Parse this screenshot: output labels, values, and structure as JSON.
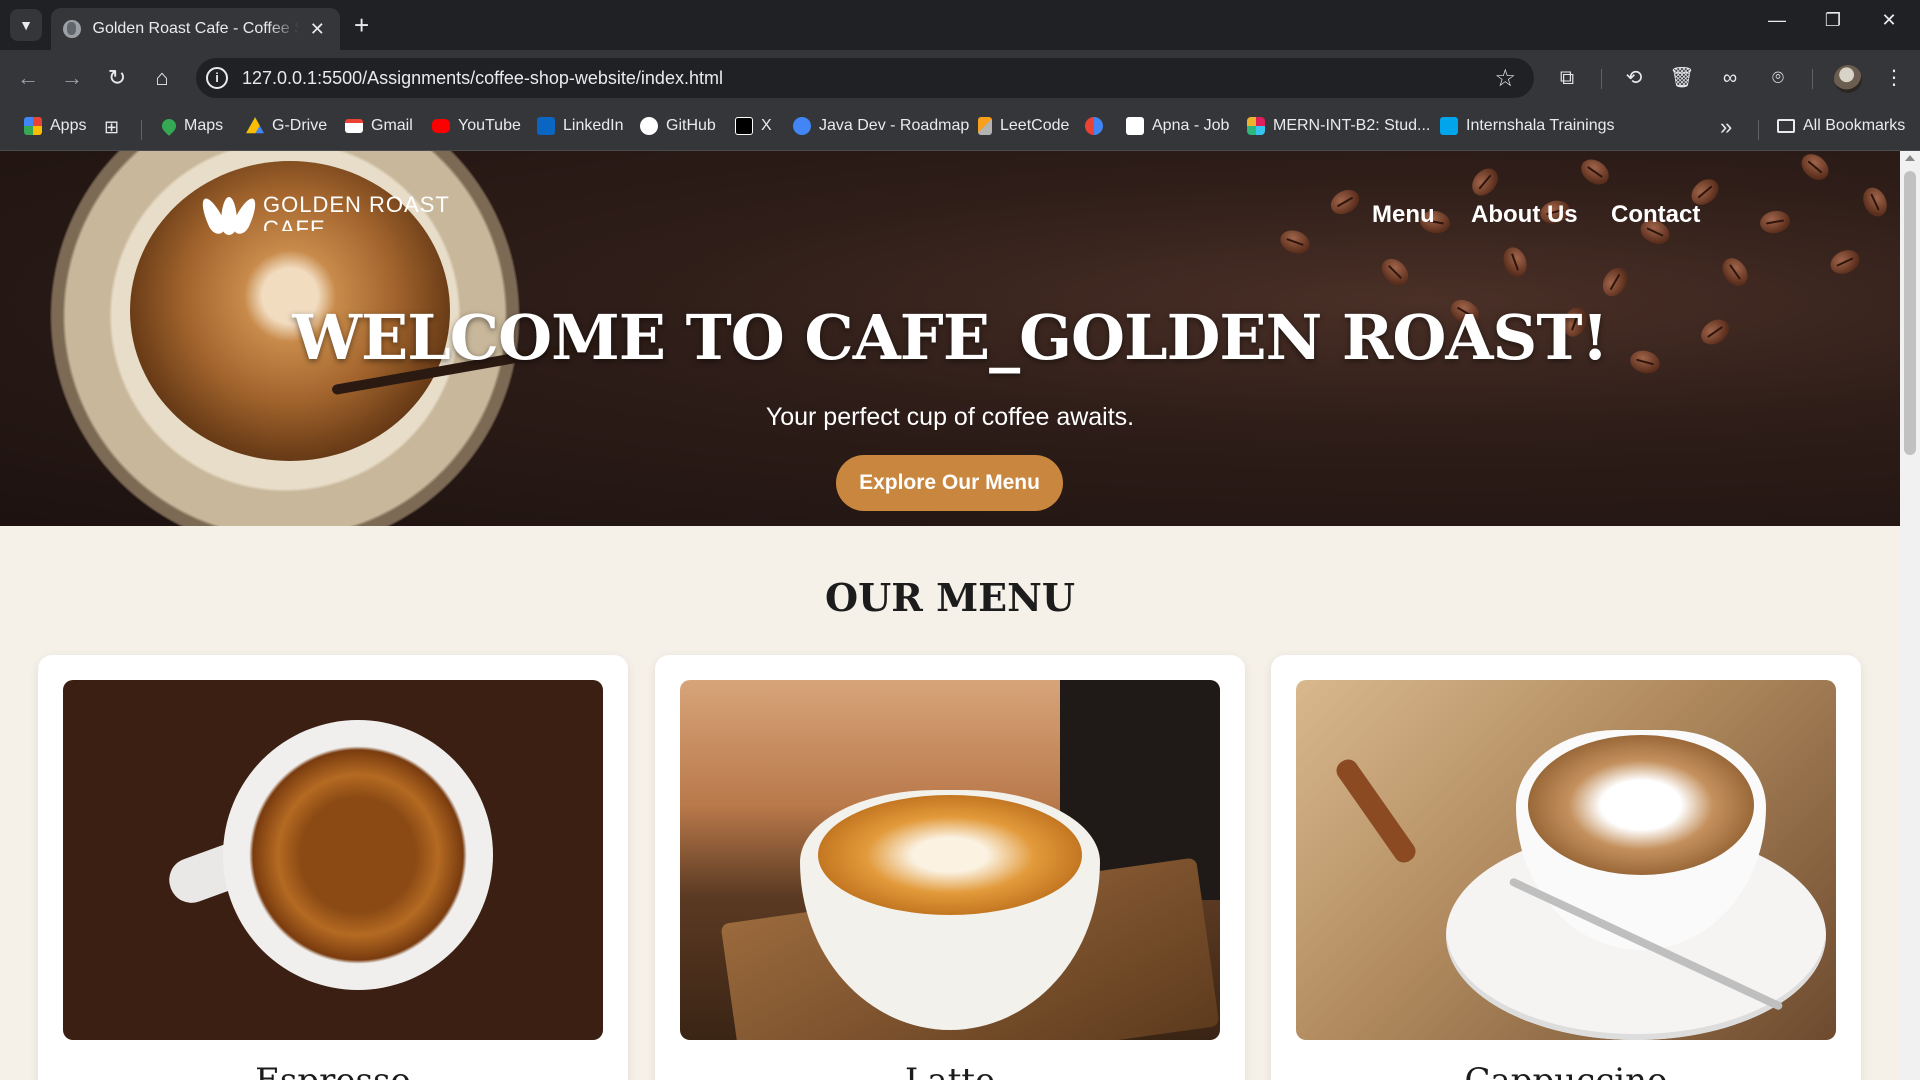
{
  "browser": {
    "tab_title": "Golden Roast Cafe - Coffee Shop",
    "tab_close": "✕",
    "new_tab": "+",
    "url": "127.0.0.1:5500/Assignments/coffee-shop-website/index.html",
    "window_controls": {
      "minimize": "—",
      "restore": "❐",
      "close": "✕"
    },
    "bookmarks": [
      {
        "label": "Apps",
        "icon": "apps-grid-icon",
        "color": "#ea4335"
      },
      {
        "label": "Maps",
        "icon": "maps-pin-icon",
        "color": "#34a853"
      },
      {
        "label": "G-Drive",
        "icon": "drive-icon",
        "color": "#fbbc04"
      },
      {
        "label": "Gmail",
        "icon": "gmail-icon",
        "color": "#ea4335"
      },
      {
        "label": "YouTube",
        "icon": "youtube-icon",
        "color": "#ff0000"
      },
      {
        "label": "LinkedIn",
        "icon": "linkedin-icon",
        "color": "#0a66c2"
      },
      {
        "label": "GitHub",
        "icon": "github-icon",
        "color": "#ffffff"
      },
      {
        "label": "X",
        "icon": "x-icon",
        "color": "#000000"
      },
      {
        "label": "Java Dev - Roadmap",
        "icon": "chat-bubble-icon",
        "color": "#4285f4"
      },
      {
        "label": "LeetCode",
        "icon": "leetcode-icon",
        "color": "#f89f1b"
      },
      {
        "label": "Apna - Job",
        "icon": "apna-icon",
        "color": "#ffffff"
      },
      {
        "label": "MERN-INT-B2: Stud...",
        "icon": "slack-icon",
        "color": "#e01e5a"
      },
      {
        "label": "Internshala Trainings",
        "icon": "internshala-icon",
        "color": "#00a5ec"
      }
    ],
    "all_bookmarks": "All Bookmarks",
    "overflow": "»"
  },
  "site": {
    "logo_line1": "GOLDEN ROAST",
    "logo_line2": "CAFE",
    "nav": [
      "Menu",
      "About Us",
      "Contact"
    ],
    "hero_title": "WELCOME TO CAFE_GOLDEN ROAST!",
    "hero_subtitle": "Your perfect cup of coffee awaits.",
    "hero_button": "Explore Our Menu",
    "accent_color": "#c9863e",
    "menu_heading": "OUR MENU",
    "menu_items": [
      {
        "name": "Espresso"
      },
      {
        "name": "Latte"
      },
      {
        "name": "Cappuccino"
      }
    ]
  }
}
